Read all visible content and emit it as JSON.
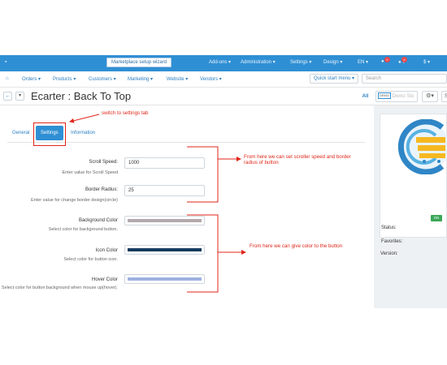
{
  "topbar": {
    "wizard_label": "Marketplace setup wizard",
    "menus": [
      "Add-ons ▾",
      "Administration ▾",
      "Settings ▾",
      "Design ▾",
      "EN ▾",
      "$ ▾"
    ],
    "notif_count_1": "0",
    "notif_count_2": "0"
  },
  "nav": {
    "items": [
      "Orders ▾",
      "Products ▾",
      "Customers ▾",
      "Marketing ▾",
      "Website ▾",
      "Vendors ▾"
    ],
    "quick_start": "Quick start menu ▾",
    "search_placeholder": "Search"
  },
  "titlebar": {
    "title": "Ecarter : Back To Top",
    "all_label": "All",
    "demo_tag": "DEMO",
    "demo_text": "Demo Sto",
    "s_label": "S"
  },
  "tabs": [
    "General",
    "Settings",
    "Information"
  ],
  "form": {
    "scroll_speed": {
      "label": "Scroll Speed:",
      "value": "1000",
      "hint": "Enter value for Scroll Speed"
    },
    "border_radius": {
      "label": "Border Radius:",
      "value": "25",
      "hint": "Enter value for change border design(circle)"
    },
    "background_color": {
      "label": "Background Color",
      "hint": "Select color for background button.",
      "color": "#b3a9ad"
    },
    "icon_color": {
      "label": "Icon Color",
      "hint": "Select color for button icon.",
      "color": "#153a5f"
    },
    "hover_color": {
      "label": "Hover Color",
      "hint": "Select color for button background when mouse up(hover).",
      "color": "#9eb1df"
    }
  },
  "sidebar": {
    "status_label": "Status:",
    "status_value": "ON",
    "favorites_label": "Favorites:",
    "version_label": "Version:"
  },
  "annotations": {
    "switch_tab": "switch to settings tab",
    "scroller_note": "From here we can set scroller speed and border radius of button",
    "color_note": "From here we can give color to the button"
  },
  "colors": {
    "topbar": "#2f8fd4",
    "accent": "#2c7fc2",
    "annotation": "#e0261a",
    "status_on": "#3aa757"
  }
}
